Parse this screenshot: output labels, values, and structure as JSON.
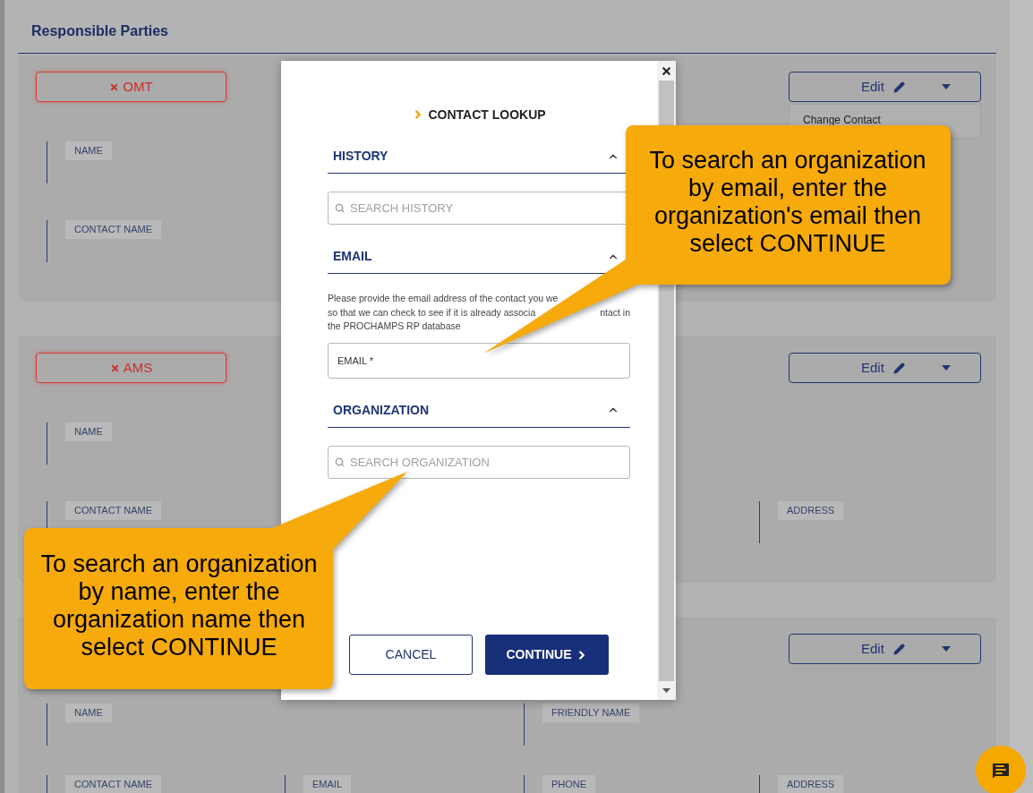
{
  "page": {
    "title": "Responsible Parties"
  },
  "cards": [
    {
      "tag": "OMT",
      "edit_label": "Edit",
      "menu_items": [
        "Change Contact"
      ],
      "rows": [
        [
          "NAME",
          null,
          null,
          null
        ],
        [
          "CONTACT NAME",
          null,
          null,
          null
        ]
      ]
    },
    {
      "tag": "AMS",
      "edit_label": "Edit",
      "rows": [
        [
          "NAME",
          null,
          null,
          null
        ],
        [
          "CONTACT NAME",
          null,
          null,
          "ADDRESS"
        ]
      ]
    },
    {
      "edit_label": "Edit",
      "rows": [
        [
          "NAME",
          null,
          "FRIENDLY NAME",
          null
        ],
        [
          "CONTACT NAME",
          "EMAIL",
          "PHONE",
          "ADDRESS"
        ]
      ]
    }
  ],
  "dialog": {
    "title": "CONTACT LOOKUP",
    "sections": [
      {
        "kind": "search",
        "title": "HISTORY",
        "expanded": true,
        "placeholder": "SEARCH HISTORY"
      },
      {
        "kind": "email",
        "title": "EMAIL",
        "expanded": true,
        "note_lines": [
          [
            "Please provide the email address of the contact you we"
          ],
          [
            "so that we can check to see if it is already associa",
            "ntact in"
          ],
          [
            "the PROCHAMPS RP database"
          ]
        ],
        "placeholder": "EMAIL *"
      },
      {
        "kind": "search",
        "title": "ORGANIZATION",
        "expanded": true,
        "placeholder": "SEARCH ORGANIZATION"
      }
    ],
    "buttons": [
      {
        "kind": "secondary",
        "label": "CANCEL"
      },
      {
        "kind": "primary",
        "label": "CONTINUE"
      }
    ]
  },
  "callouts": [
    {
      "text": "To search an organization by email, enter the organization's email then select CONTINUE"
    },
    {
      "text": "To search an organization by name, enter the organization name then select CONTINUE"
    }
  ]
}
